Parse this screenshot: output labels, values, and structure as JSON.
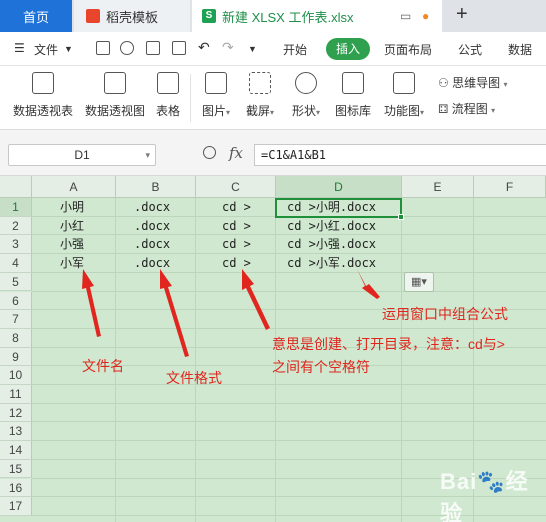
{
  "tabs": {
    "home": "首页",
    "template": "稻壳模板",
    "file": "新建 XLSX 工作表.xlsx",
    "new_tab": "+"
  },
  "menu": {
    "file": "文件",
    "items": [
      "开始",
      "插入",
      "页面布局",
      "公式",
      "数据"
    ],
    "active": "插入"
  },
  "ribbon": {
    "pivot_table": "数据透视表",
    "pivot_chart": "数据透视图",
    "table": "表格",
    "picture": "图片",
    "screenshot": "截屏",
    "shape": "形状",
    "icon_lib": "图标库",
    "function_chart": "功能图",
    "mind_map": "思维导图",
    "flow_chart": "流程图"
  },
  "formula_bar": {
    "name_box": "D1",
    "fx": "fx",
    "formula": "=C1&A1&B1"
  },
  "grid": {
    "columns": [
      "A",
      "B",
      "C",
      "D",
      "E",
      "F"
    ],
    "rows": [
      "1",
      "2",
      "3",
      "4",
      "5",
      "6",
      "7",
      "8",
      "9",
      "10",
      "11",
      "12",
      "13",
      "14",
      "15",
      "16",
      "17"
    ],
    "cells": {
      "A": [
        "小明",
        "小红",
        "小强",
        "小军"
      ],
      "B": [
        ".docx",
        ".docx",
        ".docx",
        ".docx"
      ],
      "C": [
        "cd >",
        "cd >",
        "cd >",
        "cd >"
      ],
      "D": [
        "cd >小明.docx",
        "cd >小红.docx",
        "cd >小强.docx",
        "cd >小军.docx"
      ]
    },
    "selected_cell": "D1"
  },
  "annotations": {
    "file_name": "文件名",
    "file_format": "文件格式",
    "meaning_line1": "意思是创建、打开目录，注意：cd与>",
    "meaning_line2": "之间有个空格符",
    "combine": "运用窗口中组合公式"
  },
  "colors": {
    "accent_green": "#2fa04e",
    "home_blue": "#1f73d8",
    "sheet_bg": "#cfe8cf",
    "annotation_red": "#e0261e"
  }
}
